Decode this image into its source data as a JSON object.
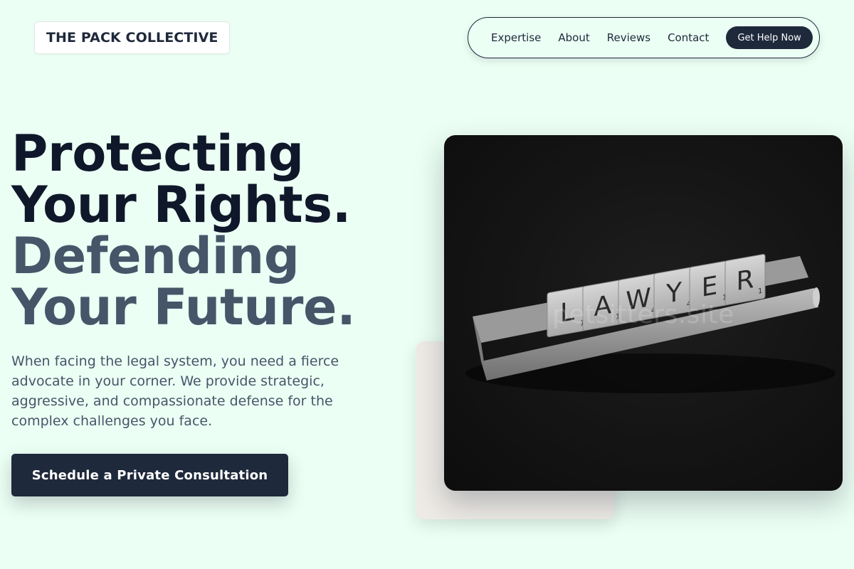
{
  "header": {
    "logo_text": "THE PACK COLLECTIVE",
    "nav": {
      "links": [
        "Expertise",
        "About",
        "Reviews",
        "Contact"
      ],
      "cta_label": "Get Help Now"
    }
  },
  "hero": {
    "title_lines": [
      "Protecting",
      "Your Rights.",
      "Defending",
      "Your Future."
    ],
    "subtitle": "When facing the legal system, you need a fierce advocate in your corner. We provide strategic, aggressive, and compassionate defense for the complex challenges you face.",
    "cta_label": "Schedule a Private Consultation",
    "image": {
      "tiles": [
        "L",
        "A",
        "W",
        "Y",
        "E",
        "R"
      ],
      "tile_scores": [
        "1",
        "1",
        "4",
        "4",
        "1",
        "1"
      ],
      "watermark": "petsitters.site"
    }
  },
  "colors": {
    "background": "#ecfff4",
    "primary": "#1e293b",
    "heading_dark": "#0f172a",
    "heading_muted": "#475569"
  }
}
